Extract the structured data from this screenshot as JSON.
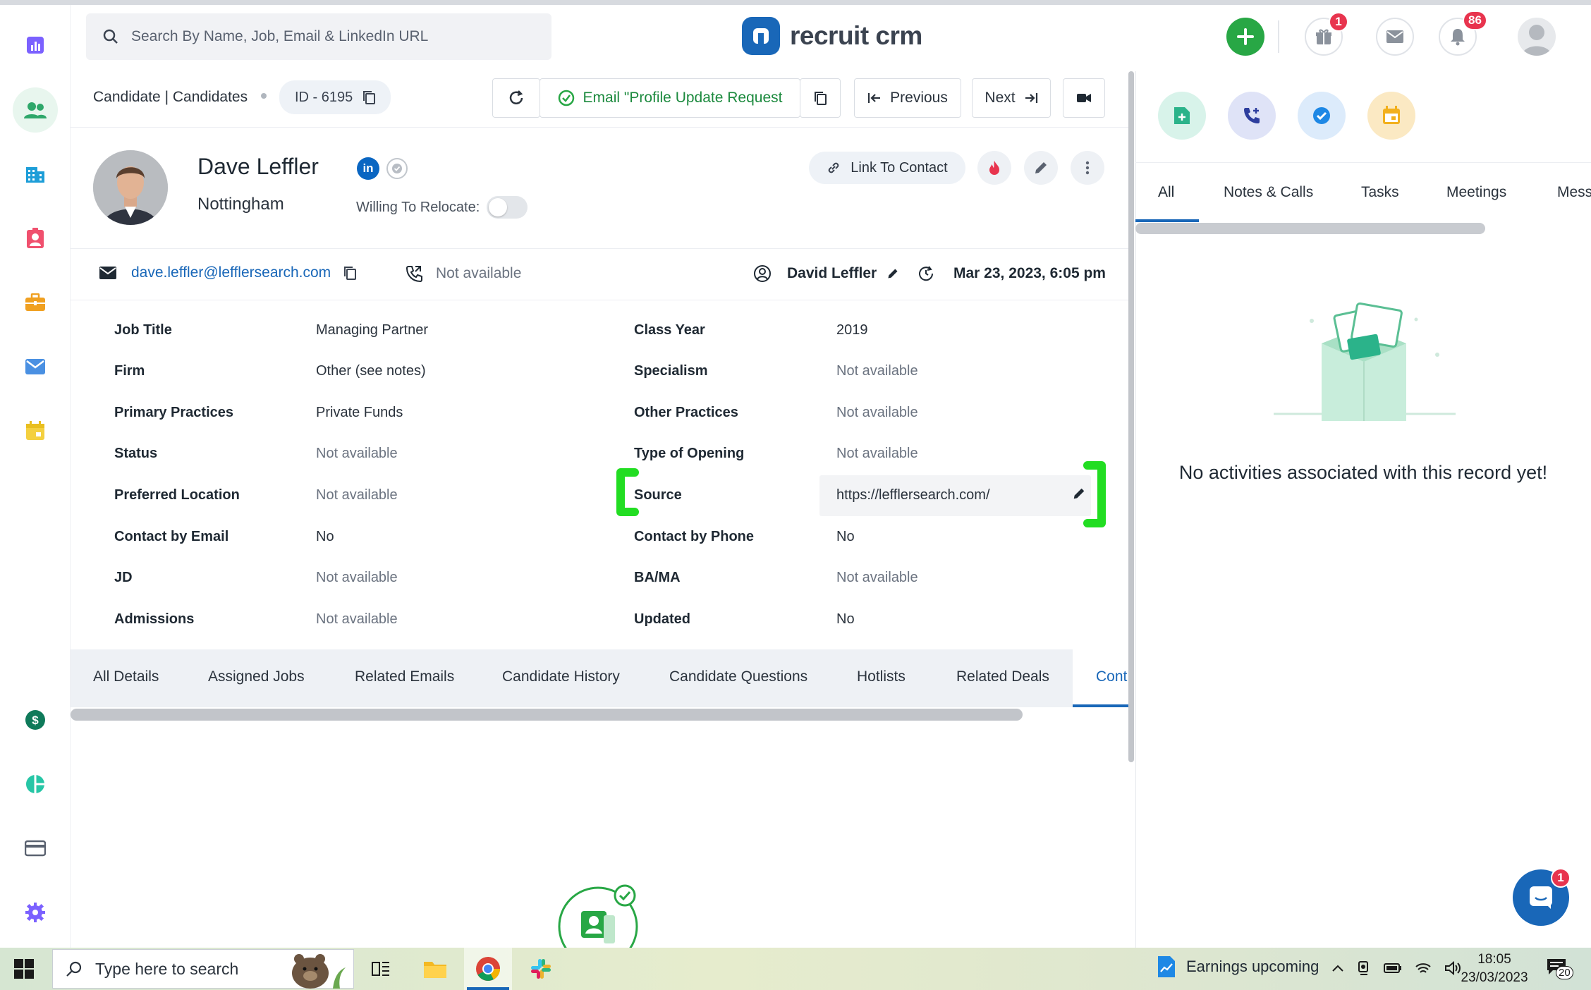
{
  "header": {
    "search_placeholder": "Search By Name, Job, Email & LinkedIn URL",
    "logo_text": "recruit crm",
    "gift_badge": "1",
    "notifications_badge": "86"
  },
  "breadcrumb": {
    "text": "Candidate | Candidates",
    "id_label": "ID - 6195"
  },
  "toolbar": {
    "email_label": "Email \"Profile Update Request",
    "previous_label": "Previous",
    "next_label": "Next"
  },
  "candidate": {
    "name": "Dave Leffler",
    "city": "Nottingham",
    "relocate_label": "Willing To Relocate:",
    "relocate_value": false,
    "link_to_contact_label": "Link To Contact",
    "email": "dave.leffler@lefflersearch.com",
    "phone": "Not available",
    "owner": "David Leffler",
    "updated_at": "Mar 23, 2023, 6:05 pm"
  },
  "details_left": [
    {
      "label": "Job Title",
      "value": "Managing Partner"
    },
    {
      "label": "Firm",
      "value": "Other (see notes)"
    },
    {
      "label": "Primary Practices",
      "value": "Private Funds"
    },
    {
      "label": "Status",
      "value": "Not available"
    },
    {
      "label": "Preferred Location",
      "value": "Not available"
    },
    {
      "label": "Contact by Email",
      "value": "No"
    },
    {
      "label": "JD",
      "value": "Not available"
    },
    {
      "label": "Admissions",
      "value": "Not available"
    }
  ],
  "details_right": [
    {
      "label": "Class Year",
      "value": "2019"
    },
    {
      "label": "Specialism",
      "value": "Not available"
    },
    {
      "label": "Other Practices",
      "value": "Not available"
    },
    {
      "label": "Type of Opening",
      "value": "Not available"
    },
    {
      "label": "Source",
      "value": "https://lefflersearch.com/"
    },
    {
      "label": "Contact by Phone",
      "value": "No"
    },
    {
      "label": "BA/MA",
      "value": "Not available"
    },
    {
      "label": "Updated",
      "value": "No"
    }
  ],
  "tabs": [
    "All Details",
    "Assigned Jobs",
    "Related Emails",
    "Candidate History",
    "Candidate Questions",
    "Hotlists",
    "Related Deals",
    "Cont"
  ],
  "activity": {
    "tabs": [
      "All",
      "Notes & Calls",
      "Tasks",
      "Meetings",
      "Mess"
    ],
    "empty_text": "No activities associated with this record yet!",
    "chat_badge": "1"
  },
  "taskbar": {
    "search_placeholder": "Type here to search",
    "news_text": "Earnings upcoming",
    "time": "18:05",
    "date": "23/03/2023",
    "notif_count": "20"
  },
  "colors": {
    "brand_blue": "#1967b8",
    "green": "#28a745",
    "highlight_green": "#22dd22",
    "badge_red": "#e8344e"
  }
}
